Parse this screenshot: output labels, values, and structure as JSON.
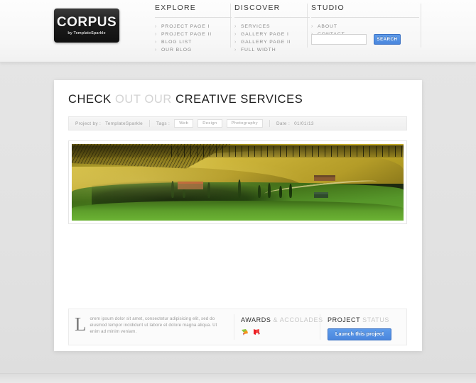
{
  "header": {
    "logo": {
      "brand": "CORPUS",
      "tagline": "by TemplateSparkle"
    },
    "columns": [
      {
        "title": "EXPLORE",
        "items": [
          "PROJECT PAGE I",
          "PROJECT PAGE II",
          "BLOG LIST",
          "OUR BLOG"
        ]
      },
      {
        "title": "DISCOVER",
        "items": [
          "SERVICES",
          "GALLERY PAGE I",
          "GALLERY PAGE II",
          "FULL WIDTH"
        ]
      },
      {
        "title": "STUDIO",
        "items": [
          "ABOUT",
          "CONTACT"
        ]
      }
    ],
    "search": {
      "value": "",
      "placeholder": "",
      "button_label": "SEARCH"
    },
    "chevron": "›"
  },
  "main": {
    "title": {
      "part1": "CHECK",
      "part2": "OUT OUR",
      "part3": "CREATIVE SERVICES"
    },
    "meta": {
      "project_by_label": "Project by :",
      "project_by_value": "TemplateSparkle",
      "tags_label": "Tags :",
      "tags": [
        "Web",
        "Design",
        "Photography"
      ],
      "date_label": "Date :",
      "date_value": "01/01/13"
    },
    "photo_alt": "tuscany-landscape-photo",
    "info": {
      "dropcap": "L",
      "body": "orem ipsum dolor sit amet, consectetur adipisicing elit, sed do eiusmod tempor incididunt ut labore et dolore magna aliqua. Ut enim ad minim veniam.",
      "awards": {
        "dark": "AWARDS",
        "light": "& ACCOLADES",
        "icons": [
          "award-ribbon-green-icon",
          "award-ribbon-red-icon"
        ]
      },
      "status": {
        "dark": "PROJECT",
        "light": "STATUS",
        "button_label": "Launch this project"
      }
    }
  },
  "colors": {
    "accent_blue": "#4a86dd",
    "page_bg": "#e4e4e4",
    "card_bg": "#ffffff",
    "title_dark": "#1d1d1d",
    "title_light": "#d3d3d3"
  }
}
